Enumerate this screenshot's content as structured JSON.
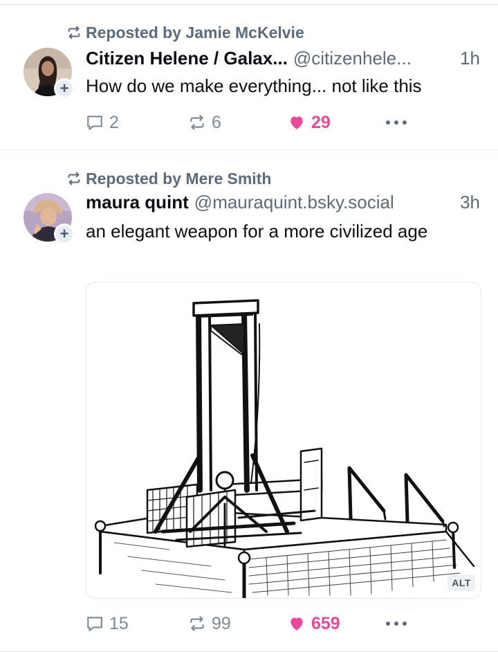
{
  "posts": [
    {
      "repost_label": "Reposted by Jamie McKelvie",
      "display_name": "Citizen Helene / Galax...",
      "handle": "@citizenhele...",
      "time": "1h",
      "text": "How do we make everything... not like this",
      "stats": {
        "replies": "2",
        "reposts": "6",
        "likes": "29"
      },
      "liked": true
    },
    {
      "repost_label": "Reposted by Mere Smith",
      "display_name": "maura quint",
      "handle": "@mauraquint.bsky.social",
      "time": "3h",
      "text": "an elegant weapon for a more civilized age",
      "media_alt_badge": "ALT",
      "stats": {
        "replies": "15",
        "reposts": "99",
        "likes": "659"
      },
      "liked": true
    }
  ],
  "icons": {
    "repost": "repost-icon",
    "reply": "reply-icon",
    "like": "heart-icon",
    "more": "more-dots-icon",
    "follow": "plus-icon"
  },
  "colors": {
    "like": "#ec4899",
    "muted": "#5b6b7b",
    "divider": "#e3e8ee"
  }
}
